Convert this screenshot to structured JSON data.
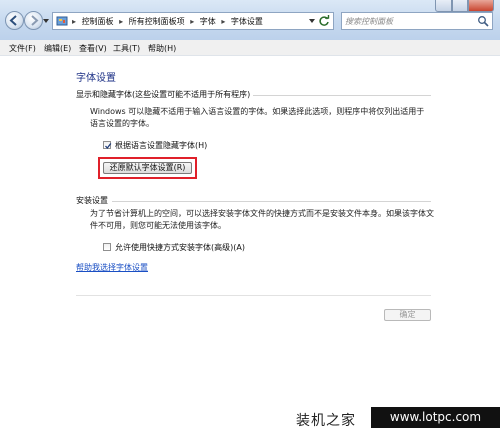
{
  "address": {
    "crumbs": [
      "控制面板",
      "所有控制面板项",
      "字体",
      "字体设置"
    ]
  },
  "search": {
    "placeholder": "搜索控制面板"
  },
  "menu": {
    "file": "文件(F)",
    "edit": "编辑(E)",
    "view": "查看(V)",
    "tools": "工具(T)",
    "help": "帮助(H)"
  },
  "main": {
    "title": "字体设置",
    "group1": {
      "header": "显示和隐藏字体(这些设置可能不适用于所有程序)",
      "description": "Windows 可以隐藏不适用于输入语言设置的字体。如果选择此选项，则程序中将仅列出适用于语言设置的字体。",
      "checkbox_label": "根据语言设置隐藏字体(H)",
      "checkbox_checked": true,
      "restore_button": "还原默认字体设置(R)"
    },
    "group2": {
      "header": "安装设置",
      "description": "为了节省计算机上的空间，可以选择安装字体文件的快捷方式而不是安装文件本身。如果该字体文件不可用，则您可能无法使用该字体。",
      "checkbox_label": "允许使用快捷方式安装字体(高级)(A)",
      "checkbox_checked": false
    },
    "help_link": "帮助我选择字体设置",
    "ok_button": "确定"
  },
  "watermark": {
    "brand": "装机之家",
    "url": "www.lotpc.com"
  },
  "colors": {
    "title_blue": "#1e3287",
    "link_blue": "#1a4fc4",
    "highlight_red": "#e0202a"
  }
}
